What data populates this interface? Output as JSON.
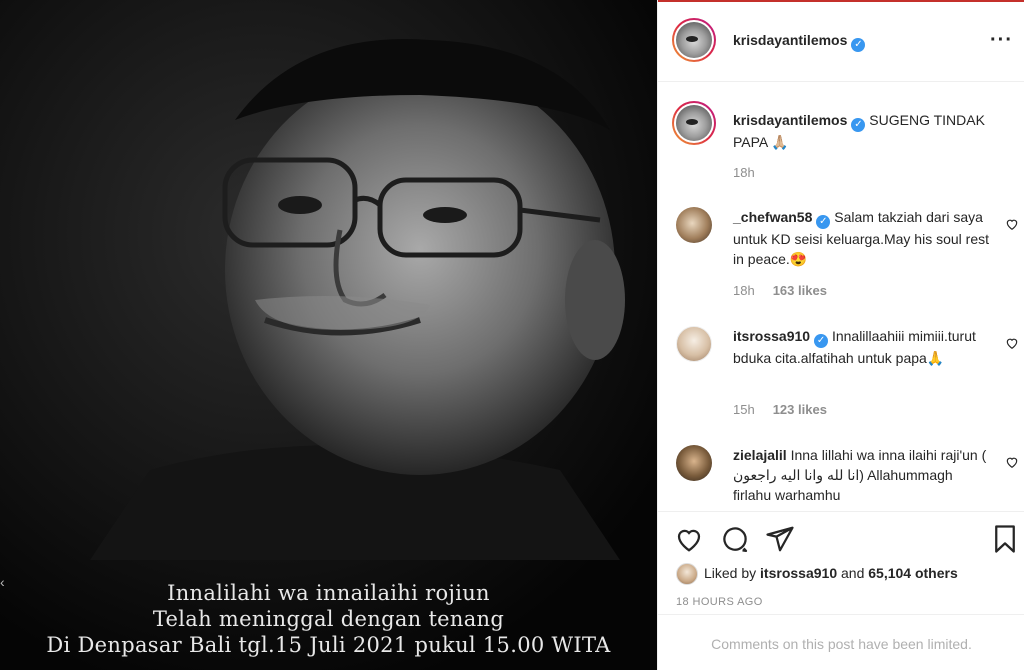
{
  "post": {
    "username": "krisdayantilemos",
    "more_icon": "more-horizontal-icon",
    "image_caption": {
      "line1": "Innalilahi wa innailaihi rojiun",
      "line2": "Telah meninggal dengan tenang",
      "line3": "Di Denpasar Bali  tgl.15 Juli 2021 pukul 15.00 WITA"
    }
  },
  "caption": {
    "username": "krisdayantilemos",
    "text": "SUGENG TINDAK PAPA 🙏🏼",
    "time": "18h"
  },
  "comments": [
    {
      "username": "_chefwan58",
      "verified": true,
      "text": "Salam takziah dari saya untuk KD seisi keluarga.May his soul rest in peace.😍",
      "time": "18h",
      "likes": "163 likes"
    },
    {
      "username": "itsrossa910",
      "verified": true,
      "text": "Innalillaahiii mimiii.turut bduka cita.alfatihah untuk papa🙏",
      "time": "15h",
      "likes": "123 likes"
    },
    {
      "username": "zielajalil",
      "verified": false,
      "text": "Inna lillahi wa inna ilaihi raji'un ( انا لله وانا اليه راجعون) Allahummagh firlahu warhamhu",
      "time": "",
      "likes": ""
    }
  ],
  "actions": {
    "liked_by_prefix": "Liked by",
    "liked_by_user": "itsrossa910",
    "liked_by_and": "and",
    "liked_by_count": "65,104 others",
    "timestamp": "18 HOURS AGO",
    "comments_limited": "Comments on this post have been limited."
  },
  "colors": {
    "verified": "#3897f0",
    "secondary_text": "#8e8e8e",
    "story_ring": "#dc2743"
  }
}
